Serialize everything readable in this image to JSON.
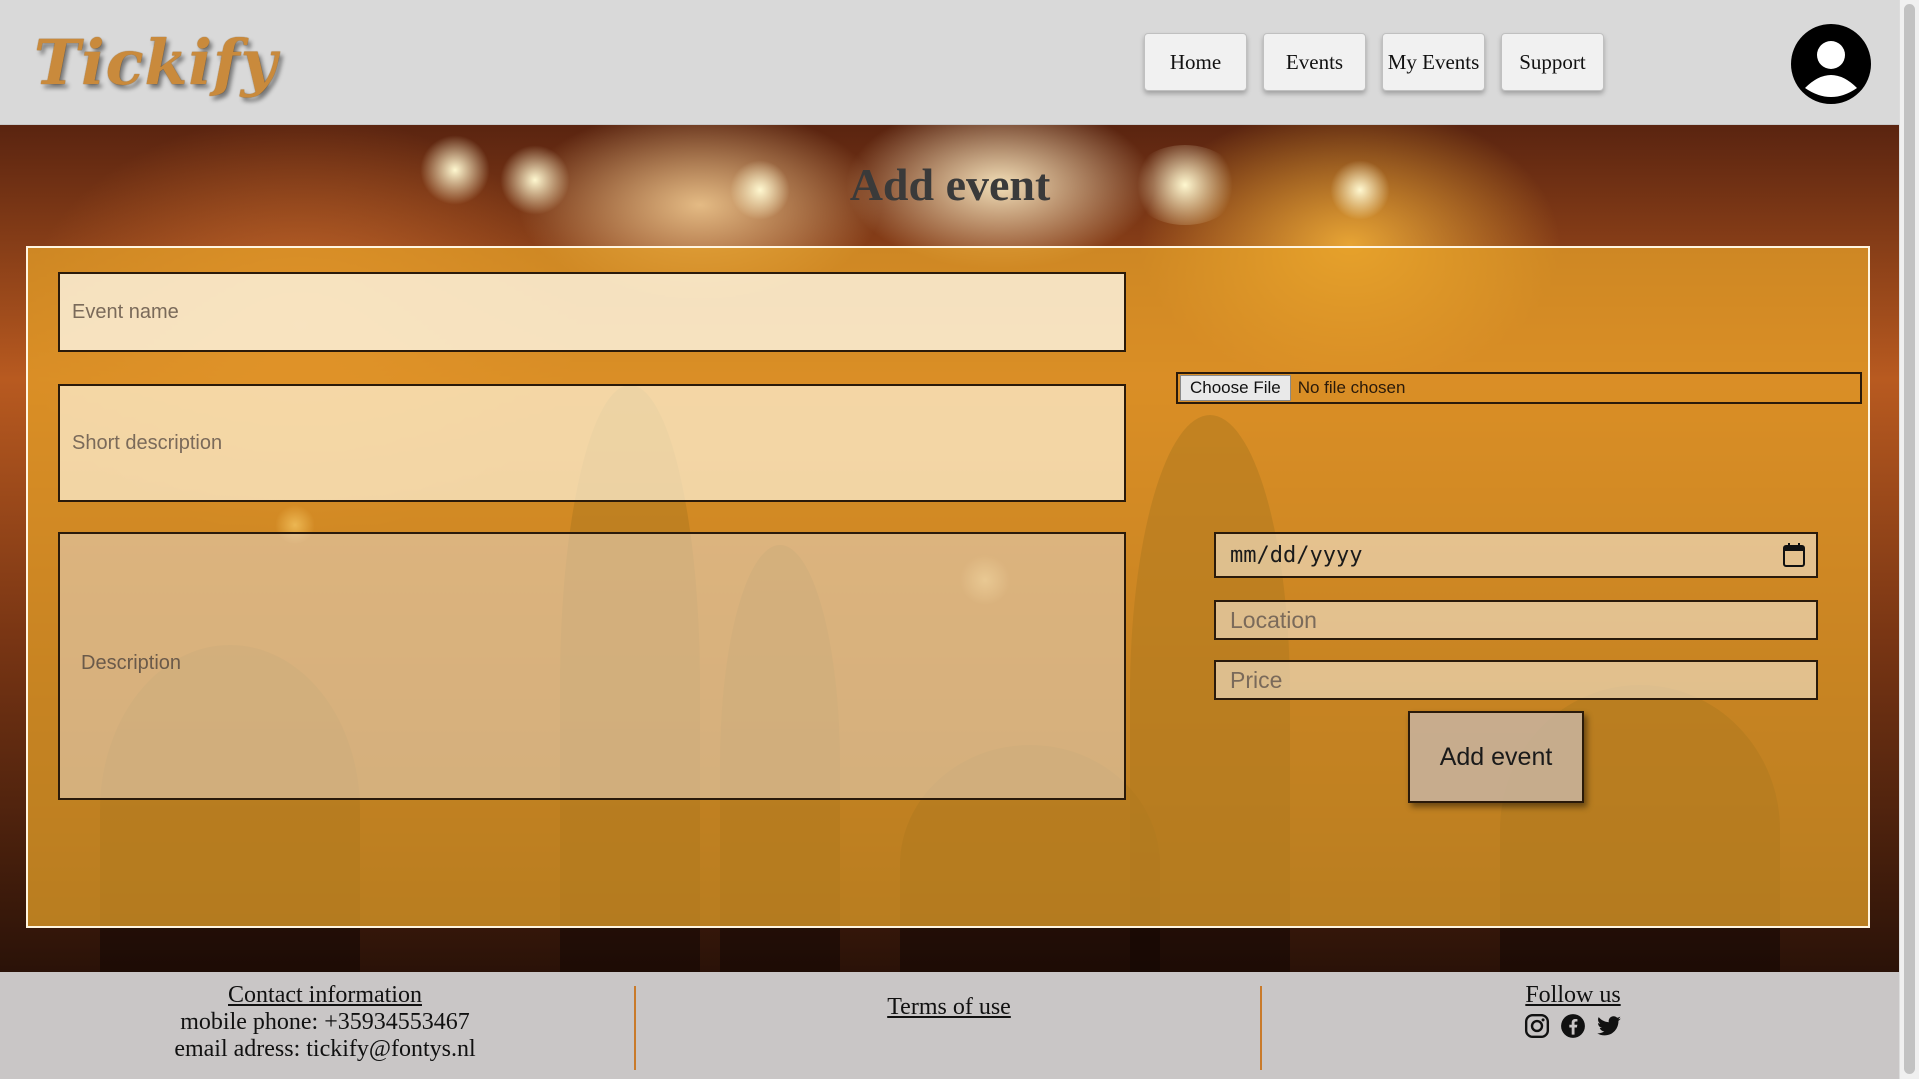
{
  "app": {
    "logo": "Tickify"
  },
  "nav": {
    "items": [
      {
        "label": "Home"
      },
      {
        "label": "Events"
      },
      {
        "label": "My Events"
      },
      {
        "label": "Support"
      }
    ]
  },
  "page": {
    "title": "Add event"
  },
  "form": {
    "event_name_placeholder": "Event name",
    "short_description_placeholder": "Short description",
    "description_label": "Description",
    "file_button": "Choose File",
    "file_status": "No file chosen",
    "date_placeholder": "mm/dd/yyyy",
    "location_placeholder": "Location",
    "price_placeholder": "Price",
    "submit_label": "Add event"
  },
  "footer": {
    "contact_title": "Contact information",
    "phone": "mobile phone: +35934553467",
    "email": "email adress: tickify@fontys.nl",
    "terms": "Terms of use",
    "follow": "Follow us",
    "social_icons": [
      "instagram-icon",
      "facebook-icon",
      "twitter-icon"
    ]
  },
  "colors": {
    "accent": "#e6a028",
    "logo": "#c98a3c",
    "divider": "#c97a2a"
  }
}
